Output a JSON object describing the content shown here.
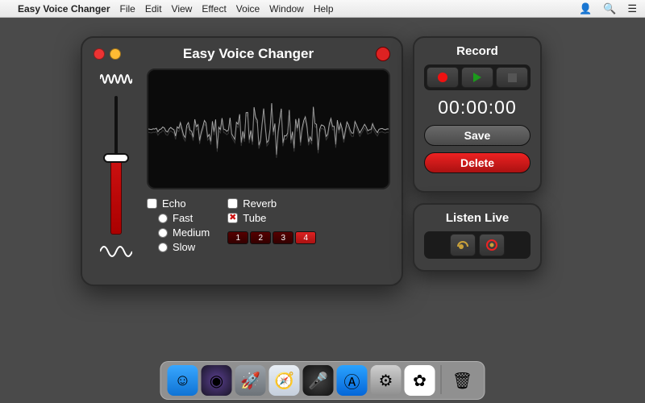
{
  "menubar": {
    "app": "Easy Voice Changer",
    "items": [
      "File",
      "Edit",
      "View",
      "Effect",
      "Voice",
      "Window",
      "Help"
    ]
  },
  "window": {
    "title": "Easy Voice Changer"
  },
  "slider": {
    "percent": 55
  },
  "effects": {
    "echo": {
      "label": "Echo",
      "checked": false,
      "options": [
        "Fast",
        "Medium",
        "Slow"
      ]
    },
    "reverb": {
      "label": "Reverb",
      "checked": false
    },
    "tube": {
      "label": "Tube",
      "checked": true
    }
  },
  "presets": {
    "labels": [
      "1",
      "2",
      "3",
      "4"
    ],
    "selected": 3
  },
  "record": {
    "title": "Record",
    "timer": "00:00:00",
    "save_label": "Save",
    "delete_label": "Delete"
  },
  "listen": {
    "title": "Listen Live"
  },
  "dock": {
    "items": [
      {
        "name": "finder",
        "bg": "linear-gradient(#38a7ff,#0f73d4)",
        "glyph": "☺"
      },
      {
        "name": "siri",
        "bg": "radial-gradient(circle,#5a3f8f,#1a1628)",
        "glyph": "◉"
      },
      {
        "name": "launchpad",
        "bg": "linear-gradient(#9aa1a8,#6d7379)",
        "glyph": "🚀"
      },
      {
        "name": "safari",
        "bg": "linear-gradient(#e8eef5,#c6d0dd)",
        "glyph": "🧭"
      },
      {
        "name": "voice-changer",
        "bg": "radial-gradient(circle,#444,#111)",
        "glyph": "🎤"
      },
      {
        "name": "app-store",
        "bg": "linear-gradient(#2aa3ff,#0566d8)",
        "glyph": "Ⓐ"
      },
      {
        "name": "settings",
        "bg": "linear-gradient(#cfcfcf,#8e8e8e)",
        "glyph": "⚙"
      },
      {
        "name": "photos",
        "bg": "#fff",
        "glyph": "✿"
      }
    ],
    "trash": {
      "name": "trash",
      "glyph": "🗑"
    }
  }
}
